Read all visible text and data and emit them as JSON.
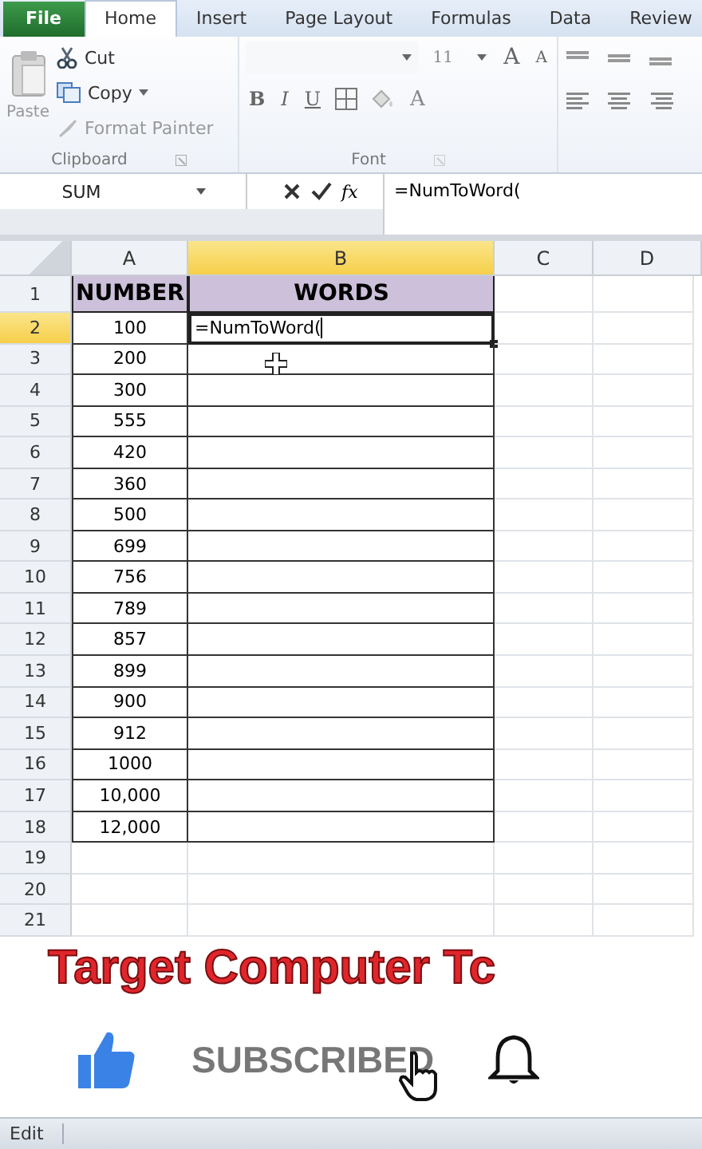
{
  "tabs": [
    {
      "label": "File",
      "kind": "file",
      "selected": false
    },
    {
      "label": "Home",
      "kind": "tab",
      "selected": true
    },
    {
      "label": "Insert",
      "kind": "tab",
      "selected": false
    },
    {
      "label": "Page Layout",
      "kind": "tab",
      "selected": false
    },
    {
      "label": "Formulas",
      "kind": "tab",
      "selected": false
    },
    {
      "label": "Data",
      "kind": "tab",
      "selected": false
    },
    {
      "label": "Review",
      "kind": "tab",
      "selected": false
    }
  ],
  "ribbon": {
    "clipboard": {
      "label": "Clipboard",
      "paste": "Paste",
      "cut": "Cut",
      "copy": "Copy",
      "format_painter": "Format Painter"
    },
    "font": {
      "label": "Font",
      "size": "11",
      "grow": "A",
      "shrink": "A",
      "bold": "B",
      "italic": "I",
      "underline": "U",
      "font_color": "A"
    }
  },
  "formula_bar": {
    "name_box": "SUM",
    "fx": "fx",
    "formula": "=NumToWord("
  },
  "columns": [
    {
      "label": "A",
      "selected": false
    },
    {
      "label": "B",
      "selected": true
    },
    {
      "label": "C",
      "selected": false
    },
    {
      "label": "D",
      "selected": false
    }
  ],
  "rows": [
    {
      "label": "1",
      "kind": "header",
      "selected": false,
      "cells": [
        "NUMBER",
        "WORDS"
      ]
    },
    {
      "label": "2",
      "kind": "data",
      "selected": true,
      "cells": [
        "100",
        "=NumToWord("
      ]
    },
    {
      "label": "3",
      "kind": "data",
      "selected": false,
      "cells": [
        "200",
        ""
      ]
    },
    {
      "label": "4",
      "kind": "data",
      "selected": false,
      "cells": [
        "300",
        ""
      ]
    },
    {
      "label": "5",
      "kind": "data",
      "selected": false,
      "cells": [
        "555",
        ""
      ]
    },
    {
      "label": "6",
      "kind": "data",
      "selected": false,
      "cells": [
        "420",
        ""
      ]
    },
    {
      "label": "7",
      "kind": "data",
      "selected": false,
      "cells": [
        "360",
        ""
      ]
    },
    {
      "label": "8",
      "kind": "data",
      "selected": false,
      "cells": [
        "500",
        ""
      ]
    },
    {
      "label": "9",
      "kind": "data",
      "selected": false,
      "cells": [
        "699",
        ""
      ]
    },
    {
      "label": "10",
      "kind": "data",
      "selected": false,
      "cells": [
        "756",
        ""
      ]
    },
    {
      "label": "11",
      "kind": "data",
      "selected": false,
      "cells": [
        "789",
        ""
      ]
    },
    {
      "label": "12",
      "kind": "data",
      "selected": false,
      "cells": [
        "857",
        ""
      ]
    },
    {
      "label": "13",
      "kind": "data",
      "selected": false,
      "cells": [
        "899",
        ""
      ]
    },
    {
      "label": "14",
      "kind": "data",
      "selected": false,
      "cells": [
        "900",
        ""
      ]
    },
    {
      "label": "15",
      "kind": "data",
      "selected": false,
      "cells": [
        "912",
        ""
      ]
    },
    {
      "label": "16",
      "kind": "data",
      "selected": false,
      "cells": [
        "1000",
        ""
      ]
    },
    {
      "label": "17",
      "kind": "data",
      "selected": false,
      "cells": [
        "10,000",
        ""
      ]
    },
    {
      "label": "18",
      "kind": "data",
      "selected": false,
      "cells": [
        "12,000",
        ""
      ]
    },
    {
      "label": "19",
      "kind": "blank",
      "selected": false,
      "cells": [
        "",
        ""
      ]
    },
    {
      "label": "20",
      "kind": "blank",
      "selected": false,
      "cells": [
        "",
        ""
      ]
    },
    {
      "label": "21",
      "kind": "blank",
      "selected": false,
      "cells": [
        "",
        ""
      ]
    }
  ],
  "overlay": {
    "title": "Target Computer Tc",
    "button": "SUBSCRIBED"
  },
  "status_bar": {
    "mode": "Edit"
  }
}
